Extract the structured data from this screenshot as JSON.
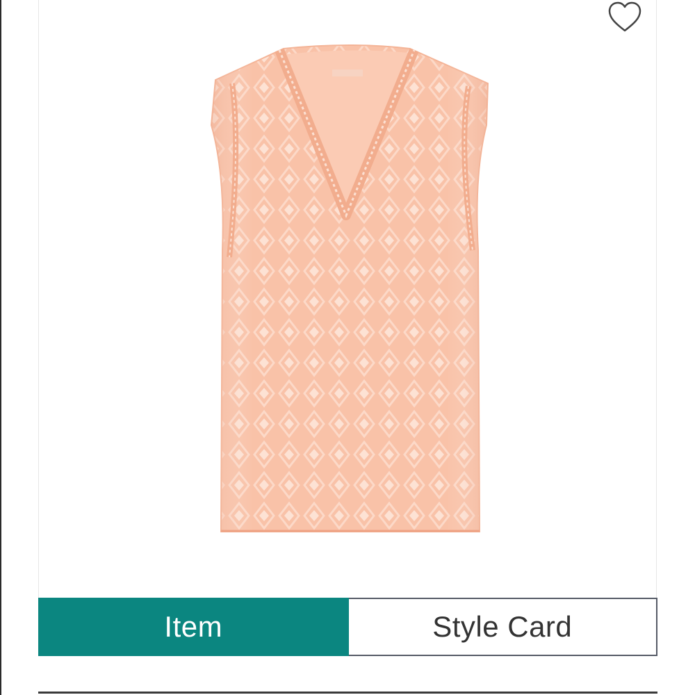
{
  "product": {
    "image_icon": "sleeveless-v-neck-lace-blouse",
    "color": "#f9c2a8",
    "favorite_icon": "heart-outline-icon"
  },
  "tabs": [
    {
      "label": "Item",
      "active": true
    },
    {
      "label": "Style Card",
      "active": false
    }
  ],
  "colors": {
    "accent": "#0b8680",
    "inactive_border": "#555a66"
  }
}
